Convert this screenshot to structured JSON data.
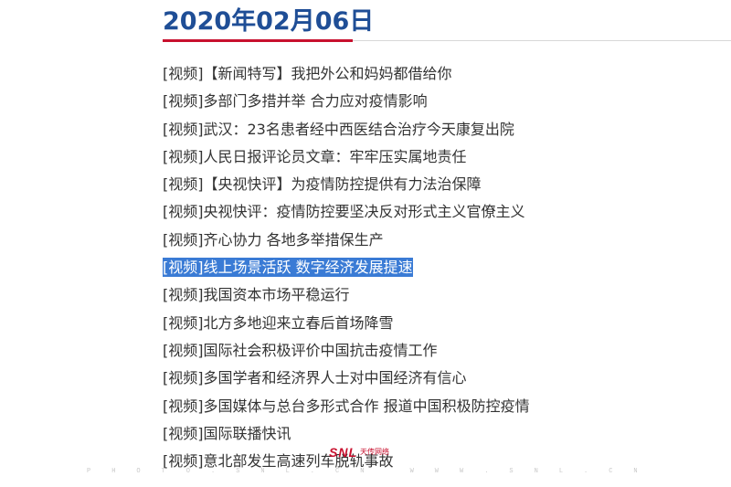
{
  "header": {
    "date_title": "2020年02月06日",
    "accent_color": "#c8102e",
    "title_color": "#1f4e96"
  },
  "news": {
    "items": [
      {
        "label": "[视频]【新闻特写】我把外公和妈妈都借给你",
        "selected": false
      },
      {
        "label": "[视频]多部门多措并举 合力应对疫情影响",
        "selected": false
      },
      {
        "label": "[视频]武汉：23名患者经中西医结合治疗今天康复出院",
        "selected": false
      },
      {
        "label": "[视频]人民日报评论员文章：牢牢压实属地责任",
        "selected": false
      },
      {
        "label": "[视频]【央视快评】为疫情防控提供有力法治保障",
        "selected": false
      },
      {
        "label": "[视频]央视快评：疫情防控要坚决反对形式主义官僚主义",
        "selected": false
      },
      {
        "label": "[视频]齐心协力 各地多举措保生产",
        "selected": false
      },
      {
        "label": "[视频]线上场景活跃 数字经济发展提速",
        "selected": true
      },
      {
        "label": "[视频]我国资本市场平稳运行",
        "selected": false
      },
      {
        "label": "[视频]北方多地迎来立春后首场降雪",
        "selected": false
      },
      {
        "label": "[视频]国际社会积极评价中国抗击疫情工作",
        "selected": false
      },
      {
        "label": "[视频]多国学者和经济界人士对中国经济有信心",
        "selected": false
      },
      {
        "label": "[视频]多国媒体与总台多形式合作 报道中国积极防控疫情",
        "selected": false
      },
      {
        "label": "[视频]国际联播快讯",
        "selected": false
      },
      {
        "label": "[视频]意北部发生高速列车脱轨事故",
        "selected": false
      }
    ],
    "selection_color": "#3a7bd5"
  },
  "watermark": {
    "logo": "SNL",
    "cn": "天传网络",
    "url": "PHOTO.SNL.CN  WWW.SNL.CN"
  }
}
